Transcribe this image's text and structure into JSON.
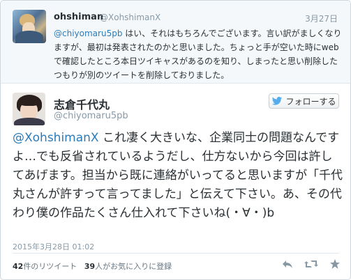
{
  "context_tweet": {
    "display_name": "ohshiman",
    "handle": "@XohshimanX",
    "date": "3月27日",
    "mention": "@chiyomaru5pb",
    "text": " はい、それはもちろんでございます。言い訳がましくなりますが、最初は発表されたのかと思いました。ちょっと手が空いた時にwebで確認したところ本日ツイキャスがあるのを知り、しまったと思い削除したつもりが別のツイートを削除しておりました。"
  },
  "main_tweet": {
    "display_name": "志倉千代丸",
    "handle": "@chiyomaru5pb",
    "follow_label": "フォローする",
    "mention": "@XohshimanX",
    "text": " これ凄く大きいな、企業同士の問題なんですよ…でも反省されているようだし、仕方ないから今回は許してあげます。担当から既に連絡がいってると思いますが「千代丸さんが許すって言ってました」と伝えて下さい。あ、その代わり僕の作品たくさん仕入れて下さいね(・∀・)b",
    "timestamp": "2015年3月28日 01:02",
    "retweet_count": "42",
    "retweet_suffix": "件のリツイート",
    "favorite_count": "39",
    "favorite_suffix": "人がお気に入りに登録"
  },
  "icons": {
    "follow": "twitter-bird-icon",
    "reply": "reply-icon",
    "retweet": "retweet-icon",
    "favorite": "star-icon"
  },
  "colors": {
    "link": "#2b7bb9",
    "muted": "#8899a6",
    "text": "#292f33"
  }
}
